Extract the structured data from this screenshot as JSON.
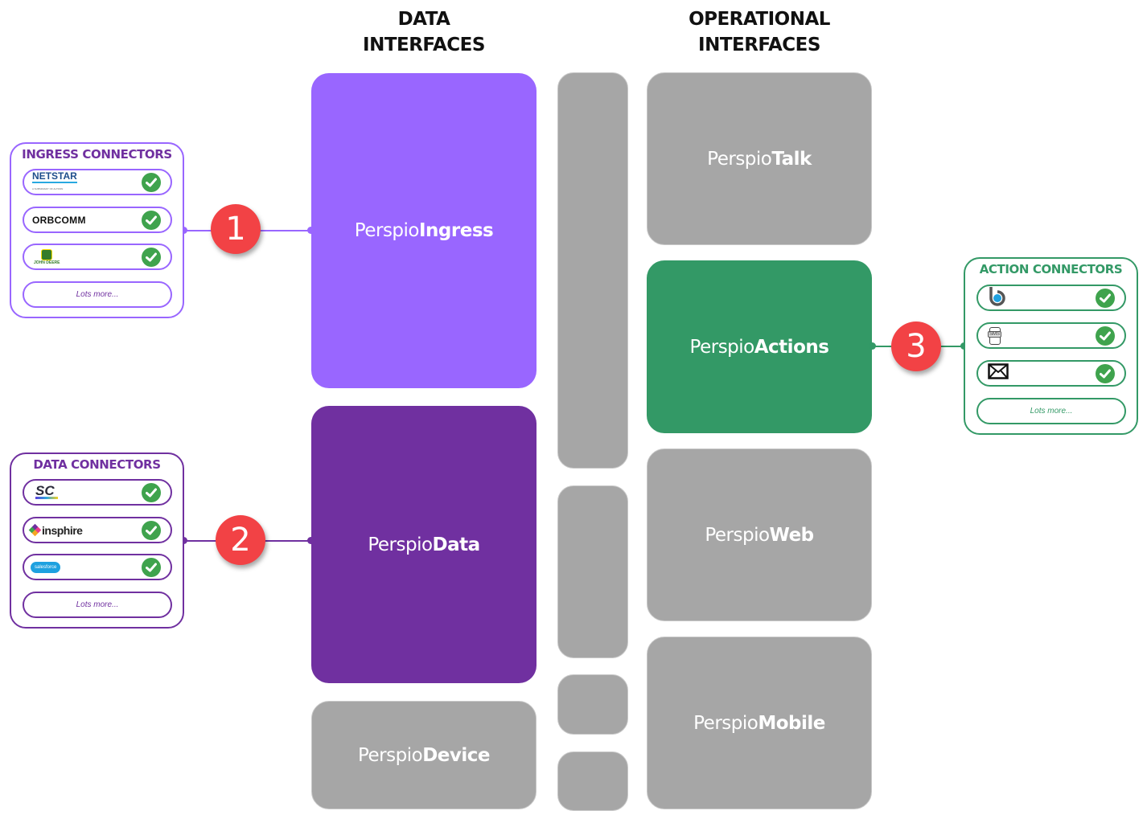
{
  "headings": {
    "data_interfaces": [
      "DATA",
      "INTERFACES"
    ],
    "operational_interfaces": [
      "OPERATIONAL",
      "INTERFACES"
    ]
  },
  "blocks": {
    "ingress": {
      "prefix": "Perspio",
      "suffix": "Ingress"
    },
    "data": {
      "prefix": "Perspio",
      "suffix": "Data"
    },
    "device": {
      "prefix": "Perspio",
      "suffix": "Device"
    },
    "talk": {
      "prefix": "Perspio",
      "suffix": "Talk"
    },
    "actions": {
      "prefix": "Perspio",
      "suffix": "Actions"
    },
    "web": {
      "prefix": "Perspio",
      "suffix": "Web"
    },
    "mobile": {
      "prefix": "Perspio",
      "suffix": "Mobile"
    }
  },
  "badges": {
    "one": "1",
    "two": "2",
    "three": "3"
  },
  "ingress_connectors": {
    "title": "INGRESS CONNECTORS",
    "color": "#7030a0",
    "border": "#9966ff",
    "items": [
      {
        "name": "NETSTAR",
        "sub": "A SUBSIDIARY OF ALTRON",
        "status": "connected"
      },
      {
        "name": "ORBCOMM",
        "status": "connected"
      },
      {
        "name": "JOHN DEERE",
        "status": "connected"
      }
    ],
    "more": "Lots more..."
  },
  "data_connectors": {
    "title": "DATA CONNECTORS",
    "color": "#7030a0",
    "border": "#7030a0",
    "items": [
      {
        "name": "SC",
        "status": "connected"
      },
      {
        "name": "insphire",
        "status": "connected"
      },
      {
        "name": "salesforce",
        "status": "connected"
      }
    ],
    "more": "Lots more..."
  },
  "action_connectors": {
    "title": "ACTION CONNECTORS",
    "color": "#339966",
    "border": "#339966",
    "items": [
      {
        "name": "b-logo-icon",
        "status": "connected"
      },
      {
        "name": "SMS",
        "status": "connected"
      },
      {
        "name": "email-icon",
        "status": "connected"
      }
    ],
    "more": "Lots more..."
  },
  "colors": {
    "ingress": "#9966ff",
    "data": "#7030a0",
    "actions": "#339966",
    "grey": "#a6a6a6",
    "badge": "#f24245",
    "check": "#3fa34d"
  }
}
